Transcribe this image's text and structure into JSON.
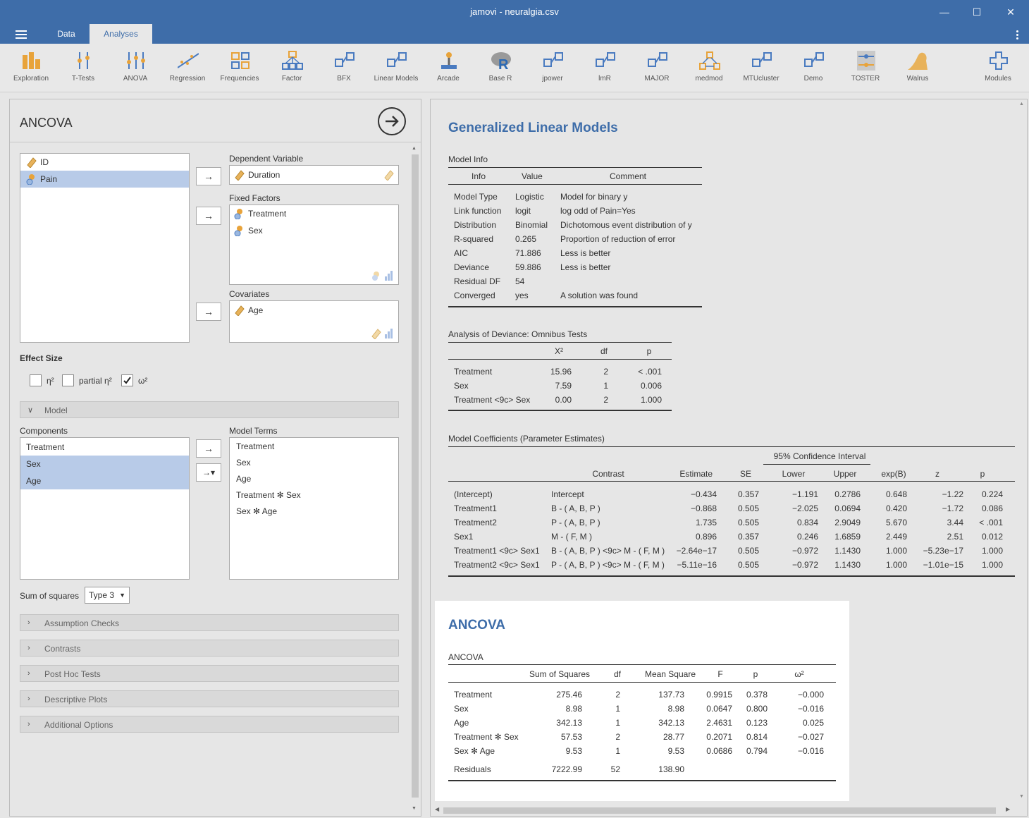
{
  "window": {
    "title": "jamovi - neuralgia.csv",
    "minimize": "—",
    "maximize": "☐",
    "close": "✕"
  },
  "tabs": {
    "data": "Data",
    "analyses": "Analyses"
  },
  "ribbon": [
    {
      "label": "Exploration",
      "icon": "exploration-icon"
    },
    {
      "label": "T-Tests",
      "icon": "ttests-icon"
    },
    {
      "label": "ANOVA",
      "icon": "anova-icon"
    },
    {
      "label": "Regression",
      "icon": "regression-icon"
    },
    {
      "label": "Frequencies",
      "icon": "frequencies-icon"
    },
    {
      "label": "Factor",
      "icon": "factor-icon"
    },
    {
      "label": "BFX",
      "icon": "bfx-icon"
    },
    {
      "label": "Linear Models",
      "icon": "linear-models-icon"
    },
    {
      "label": "Arcade",
      "icon": "arcade-icon"
    },
    {
      "label": "Base R",
      "icon": "base-r-icon"
    },
    {
      "label": "jpower",
      "icon": "jpower-icon"
    },
    {
      "label": "lmR",
      "icon": "lmr-icon"
    },
    {
      "label": "MAJOR",
      "icon": "major-icon"
    },
    {
      "label": "medmod",
      "icon": "medmod-icon"
    },
    {
      "label": "MTUcluster",
      "icon": "mtucluster-icon"
    },
    {
      "label": "Demo",
      "icon": "demo-icon"
    },
    {
      "label": "TOSTER",
      "icon": "toster-icon"
    },
    {
      "label": "Walrus",
      "icon": "walrus-icon"
    },
    {
      "label": "Modules",
      "icon": "modules-icon"
    }
  ],
  "options": {
    "title": "ANCOVA",
    "variables": [
      "ID",
      "Pain"
    ],
    "dependent_label": "Dependent Variable",
    "dependent": "Duration",
    "fixed_label": "Fixed Factors",
    "fixed": [
      "Treatment",
      "Sex"
    ],
    "covariates_label": "Covariates",
    "covariates": [
      "Age"
    ],
    "effect_size_label": "Effect Size",
    "effect_sizes": [
      {
        "label": "η²",
        "checked": false
      },
      {
        "label": "partial η²",
        "checked": false
      },
      {
        "label": "ω²",
        "checked": true
      }
    ],
    "model_section": "Model",
    "components_label": "Components",
    "components": [
      "Treatment",
      "Sex",
      "Age"
    ],
    "model_terms_label": "Model Terms",
    "model_terms": [
      "Treatment",
      "Sex",
      "Age",
      "Treatment ✻ Sex",
      "Sex ✻ Age"
    ],
    "sos_label": "Sum of squares",
    "sos_value": "Type 3",
    "sections": [
      "Assumption Checks",
      "Contrasts",
      "Post Hoc Tests",
      "Descriptive Plots",
      "Additional Options"
    ]
  },
  "results": {
    "glm_title": "Generalized Linear Models",
    "model_info": {
      "title": "Model Info",
      "headers": [
        "Info",
        "Value",
        "Comment"
      ],
      "rows": [
        [
          "Model Type",
          "Logistic",
          "Model for binary y"
        ],
        [
          "Link function",
          "logit",
          "log odd of Pain=Yes"
        ],
        [
          "Distribution",
          "Binomial",
          "Dichotomous event distribution of y"
        ],
        [
          "R-squared",
          "0.265",
          "Proportion of reduction of error"
        ],
        [
          "AIC",
          "71.886",
          "Less is better"
        ],
        [
          "Deviance",
          "59.886",
          "Less is better"
        ],
        [
          "Residual DF",
          "54",
          ""
        ],
        [
          "Converged",
          "yes",
          "A solution was found"
        ]
      ]
    },
    "omnibus": {
      "title": "Analysis of Deviance: Omnibus Tests",
      "headers": [
        "X²",
        "df",
        "p"
      ],
      "rows": [
        [
          "Treatment",
          "15.96",
          "2",
          "< .001"
        ],
        [
          "Sex",
          "7.59",
          "1",
          "0.006"
        ],
        [
          "Treatment <9c> Sex",
          "0.00",
          "2",
          "1.000"
        ]
      ]
    },
    "coef": {
      "title": "Model Coefficients (Parameter Estimates)",
      "ci_label": "95% Confidence Interval",
      "headers": [
        "Contrast",
        "Estimate",
        "SE",
        "Lower",
        "Upper",
        "exp(B)",
        "z",
        "p"
      ],
      "rows": [
        [
          "(Intercept)",
          "Intercept",
          "−0.434",
          "0.357",
          "−1.191",
          "0.2786",
          "0.648",
          "−1.22",
          "0.224"
        ],
        [
          "Treatment1",
          "B - ( A, B, P )",
          "−0.868",
          "0.505",
          "−2.025",
          "0.0694",
          "0.420",
          "−1.72",
          "0.086"
        ],
        [
          "Treatment2",
          "P - ( A, B, P )",
          "1.735",
          "0.505",
          "0.834",
          "2.9049",
          "5.670",
          "3.44",
          "< .001"
        ],
        [
          "Sex1",
          "M - ( F, M )",
          "0.896",
          "0.357",
          "0.246",
          "1.6859",
          "2.449",
          "2.51",
          "0.012"
        ],
        [
          "Treatment1 <9c> Sex1",
          "B - ( A, B, P ) <9c> M - ( F, M )",
          "−2.64e−17",
          "0.505",
          "−0.972",
          "1.1430",
          "1.000",
          "−5.23e−17",
          "1.000"
        ],
        [
          "Treatment2 <9c> Sex1",
          "P - ( A, B, P ) <9c> M - ( F, M )",
          "−5.11e−16",
          "0.505",
          "−0.972",
          "1.1430",
          "1.000",
          "−1.01e−15",
          "1.000"
        ]
      ]
    },
    "ancova_title": "ANCOVA",
    "ancova": {
      "title": "ANCOVA",
      "headers": [
        "Sum of Squares",
        "df",
        "Mean Square",
        "F",
        "p",
        "ω²"
      ],
      "rows": [
        [
          "Treatment",
          "275.46",
          "2",
          "137.73",
          "0.9915",
          "0.378",
          "−0.000"
        ],
        [
          "Sex",
          "8.98",
          "1",
          "8.98",
          "0.0647",
          "0.800",
          "−0.016"
        ],
        [
          "Age",
          "342.13",
          "1",
          "342.13",
          "2.4631",
          "0.123",
          "0.025"
        ],
        [
          "Treatment ✻ Sex",
          "57.53",
          "2",
          "28.77",
          "0.2071",
          "0.814",
          "−0.027"
        ],
        [
          "Sex ✻ Age",
          "9.53",
          "1",
          "9.53",
          "0.0686",
          "0.794",
          "−0.016"
        ]
      ],
      "residuals": [
        "Residuals",
        "7222.99",
        "52",
        "138.90"
      ]
    }
  }
}
